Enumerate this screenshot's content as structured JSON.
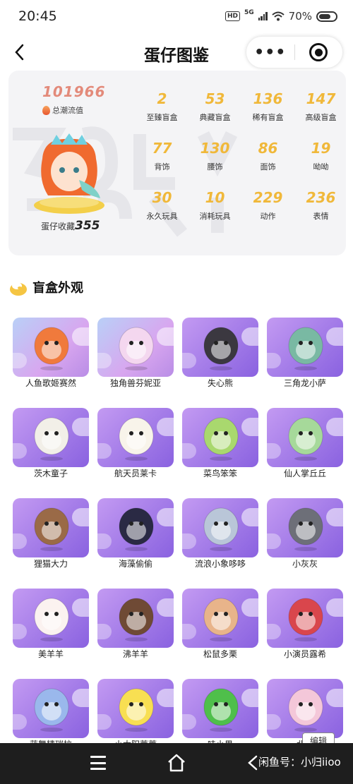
{
  "status_bar": {
    "time": "20:45",
    "network_badge": "HD",
    "signal_label": "5G",
    "battery": "70%"
  },
  "nav": {
    "title": "蛋仔图鉴",
    "more_label": "•••"
  },
  "summary": {
    "total_value": "101966",
    "total_label": "总潮流值",
    "collection_label": "蛋仔收藏",
    "collection_value": "355"
  },
  "stats": [
    {
      "value": "2",
      "label": "至臻盲盒"
    },
    {
      "value": "53",
      "label": "典藏盲盒"
    },
    {
      "value": "136",
      "label": "稀有盲盒"
    },
    {
      "value": "147",
      "label": "高级盲盒"
    },
    {
      "value": "77",
      "label": "背饰"
    },
    {
      "value": "130",
      "label": "腰饰"
    },
    {
      "value": "86",
      "label": "面饰"
    },
    {
      "value": "19",
      "label": "呦呦"
    },
    {
      "value": "30",
      "label": "永久玩具"
    },
    {
      "value": "10",
      "label": "消耗玩具"
    },
    {
      "value": "229",
      "label": "动作"
    },
    {
      "value": "236",
      "label": "表情"
    }
  ],
  "section": {
    "title": "盲盒外观"
  },
  "items": [
    {
      "name": "人鱼歌姬赛然",
      "color": "#f07a3c"
    },
    {
      "name": "独角兽芬妮亚",
      "color": "#f4d7ef"
    },
    {
      "name": "失心熊",
      "color": "#3b3840"
    },
    {
      "name": "三角龙小萨",
      "color": "#79b9a3"
    },
    {
      "name": "茨木童子",
      "color": "#f2efe8"
    },
    {
      "name": "航天员莱卡",
      "color": "#f8f4ea"
    },
    {
      "name": "菜鸟笨笨",
      "color": "#a9d86e"
    },
    {
      "name": "仙人掌丘丘",
      "color": "#a6d99a"
    },
    {
      "name": "狸猫大力",
      "color": "#9a6a47"
    },
    {
      "name": "海藻偷偷",
      "color": "#2a2a44"
    },
    {
      "name": "流浪小象哆哆",
      "color": "#b9c6d8"
    },
    {
      "name": "小灰灰",
      "color": "#6d6f78"
    },
    {
      "name": "美羊羊",
      "color": "#fbf2f0"
    },
    {
      "name": "沸羊羊",
      "color": "#6f4a35"
    },
    {
      "name": "松鼠多栗",
      "color": "#e8b48a"
    },
    {
      "name": "小演员露希",
      "color": "#d9464c"
    },
    {
      "name": "蓝舞精瑞拉",
      "color": "#9ab8ec"
    },
    {
      "name": "小太阳蒂蒂",
      "color": "#f8df52"
    },
    {
      "name": "哇小果",
      "color": "#4fbf4b"
    },
    {
      "name": "北极",
      "color": "#f4c7d9"
    }
  ],
  "bottom": {
    "watermark": "闲鱼号：小归iioo",
    "tag": "编辑"
  }
}
